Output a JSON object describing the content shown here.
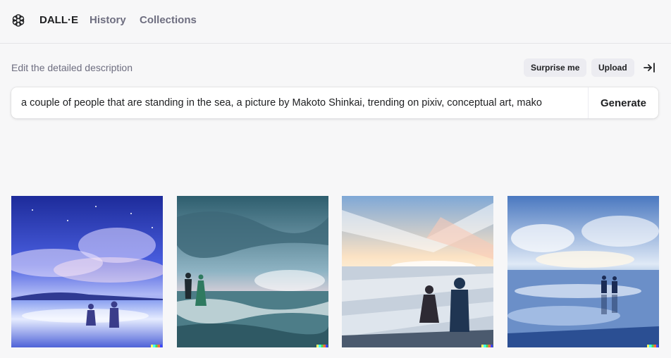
{
  "app": {
    "brand": "DALL·E"
  },
  "nav": {
    "history": "History",
    "collections": "Collections"
  },
  "editor": {
    "hint": "Edit the detailed description",
    "surprise_label": "Surprise me",
    "upload_label": "Upload",
    "prompt": "a couple of people that are standing in the sea, a picture by Makoto Shinkai, trending on pixiv, conceptual art, mako",
    "generate_label": "Generate"
  },
  "icons": {
    "logo": "openai-logo-icon",
    "collapse": "arrow-to-right-icon"
  },
  "colors": {
    "accent_dark": "#202123",
    "muted": "#6e6e80",
    "pill_bg": "#ececf1",
    "background": "#f7f7f8"
  }
}
